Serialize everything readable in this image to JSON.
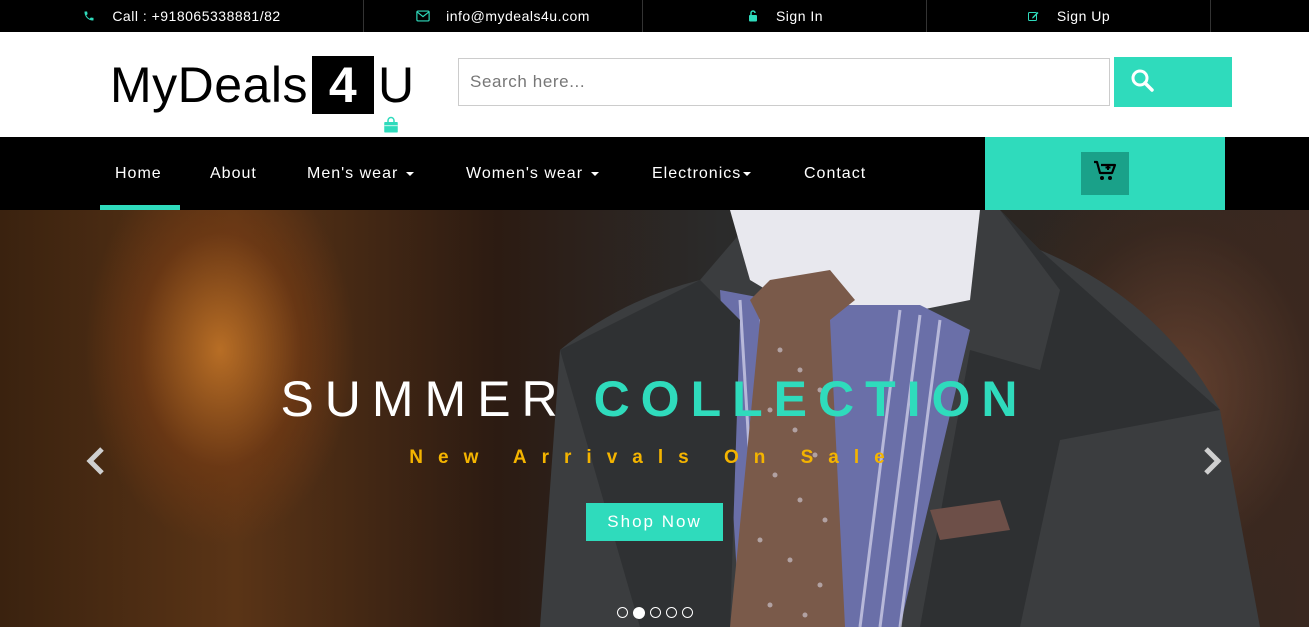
{
  "topbar": {
    "call": "Call : +918065338881/82",
    "email": "info@mydeals4u.com",
    "signin": "Sign In",
    "signup": "Sign Up"
  },
  "logo": {
    "part1": "MyDeals",
    "badge": "4",
    "part2": "U"
  },
  "search": {
    "placeholder": "Search here..."
  },
  "nav": {
    "items": [
      {
        "label": "Home",
        "dropdown": false,
        "active": true
      },
      {
        "label": "About",
        "dropdown": false
      },
      {
        "label": "Men's wear",
        "dropdown": true
      },
      {
        "label": "Women's wear",
        "dropdown": true
      },
      {
        "label": "Electronics",
        "dropdown": true
      },
      {
        "label": "Contact",
        "dropdown": false
      }
    ]
  },
  "hero": {
    "title_part1": "SUMMER",
    "title_part2": "COLLECTION",
    "subtitle": "New Arrivals On Sale",
    "button": "Shop Now",
    "slides_total": 5,
    "active_slide": 2
  },
  "colors": {
    "accent": "#2fdbbc",
    "subtitle": "#f4b400",
    "dark": "#000000"
  }
}
